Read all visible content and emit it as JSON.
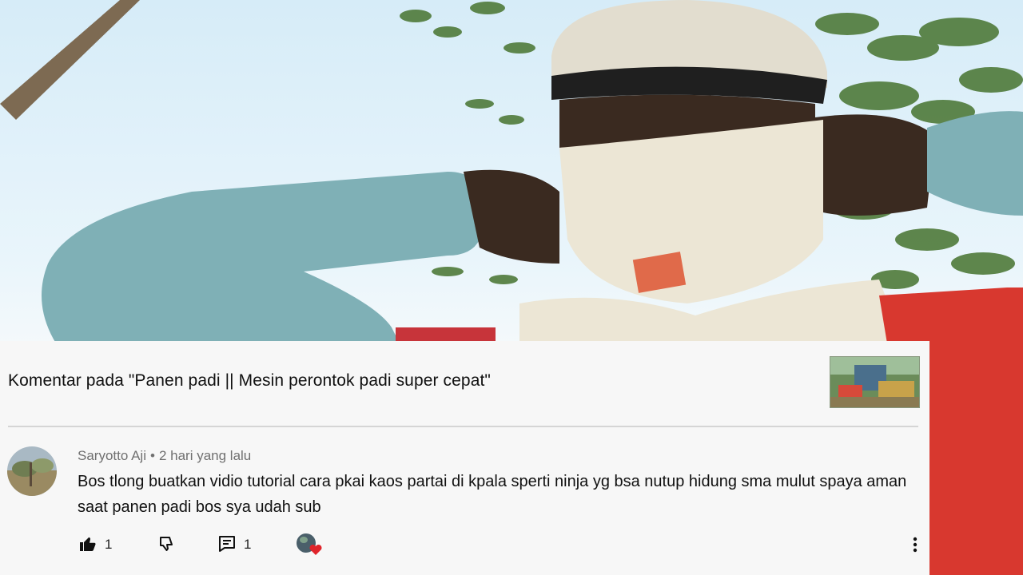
{
  "comment_panel": {
    "title": "Komentar pada \"Panen padi || Mesin perontok padi super cepat\"",
    "video_thumbnail_icon": "video-thumbnail",
    "comment": {
      "author": "Saryotto Aji",
      "separator": "•",
      "time": "2 hari yang lalu",
      "text": "Bos tlong buatkan vidio tutorial cara pkai kaos partai di kpala sperti ninja yg bsa nutup hidung sma mulut spaya aman saat panen padi bos sya udah sub"
    },
    "actions": {
      "like_icon": "thumbs-up-icon",
      "like_count": "1",
      "dislike_icon": "thumbs-down-icon",
      "reply_icon": "reply-comment-icon",
      "reply_count": "1",
      "creator_heart_icon": "creator-heart-icon",
      "more_icon": "more-vert-icon"
    }
  },
  "colors": {
    "card_bg": "#f7f7f7",
    "title_text": "#111111",
    "meta_text": "#707070",
    "heart": "#e0242b"
  }
}
